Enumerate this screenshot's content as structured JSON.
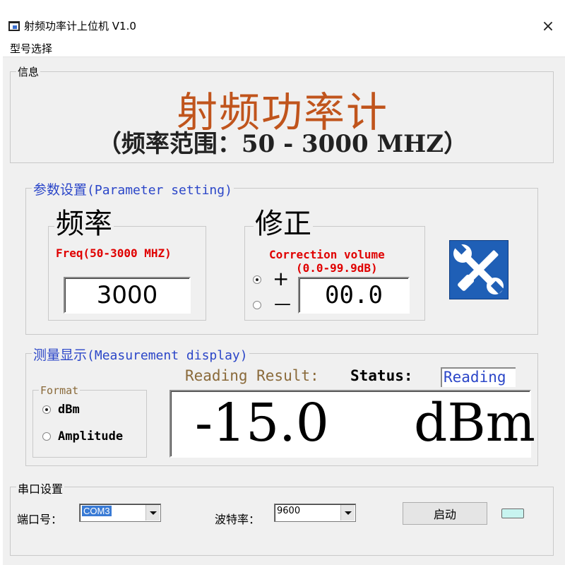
{
  "window": {
    "title": "射频功率计上位机 V1.0",
    "close_symbol": "×"
  },
  "menu": {
    "items": [
      {
        "label": "型号选择"
      }
    ]
  },
  "info": {
    "legend": "信息",
    "title": "射频功率计",
    "subtitle": "（频率范围：50 - 3000 MHZ）"
  },
  "params": {
    "legend": "参数设置",
    "legend_en": "(Parameter setting)",
    "freq": {
      "legend": "频率",
      "hint": "Freq(50-3000 MHZ)",
      "value": "3000"
    },
    "correction": {
      "legend": "修正",
      "hint": "Correction volume",
      "range": "(0.0-99.9dB)",
      "plus_label": "+",
      "minus_label": "—",
      "selected_sign": "+",
      "value": "00.0"
    },
    "tool_icon": "wrench-screwdriver-icon"
  },
  "measure": {
    "legend": "测量显示",
    "legend_en": "(Measurement display)",
    "format": {
      "legend": "Format",
      "options": [
        {
          "label": "dBm",
          "selected": true
        },
        {
          "label": "Amplitude",
          "selected": false
        }
      ]
    },
    "reading_label": "Reading Result:",
    "status_label": "Status:",
    "status_value": "Reading",
    "value": "-15.0",
    "unit": "dBm"
  },
  "serial": {
    "legend": "串口设置",
    "port_label": "端口号：",
    "port_value": "COM3",
    "baud_label": "波特率：",
    "baud_value": "9600",
    "start_label": "启动",
    "led_color": "#c8f4f0"
  },
  "colors": {
    "title_brown": "#c0541c",
    "legend_blue": "#2b46c8",
    "hint_red": "#e00000"
  }
}
